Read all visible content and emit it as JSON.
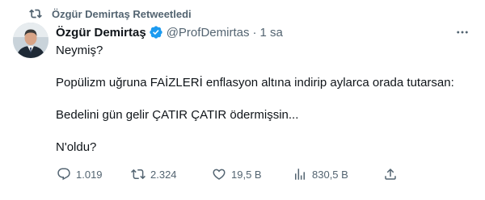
{
  "retweet_context": {
    "label": "Özgür Demirtaş Retweetledi",
    "icon": "retweet-icon"
  },
  "author": {
    "display_name": "Özgür Demirtaş",
    "handle": "@ProfDemirtas",
    "separator": "·",
    "time": "1 sa",
    "verified": true,
    "verified_color": "#1d9bf0"
  },
  "tweet": {
    "paragraphs": [
      "Neymiş?",
      "Popülizm uğruna FAİZLERİ enflasyon altına indirip aylarca orada tutarsan:",
      "Bedelini gün gelir ÇATIR ÇATIR ödermişsin...",
      "N'oldu?"
    ]
  },
  "actions": {
    "reply": {
      "count": "1.019",
      "icon": "reply-icon"
    },
    "retweet": {
      "count": "2.324",
      "icon": "retweet-icon"
    },
    "like": {
      "count": "19,5 B",
      "icon": "heart-icon"
    },
    "views": {
      "count": "830,5 B",
      "icon": "views-icon"
    },
    "share": {
      "icon": "share-icon"
    }
  },
  "colors": {
    "text": "#0f1419",
    "secondary": "#536471",
    "accent": "#1d9bf0"
  }
}
